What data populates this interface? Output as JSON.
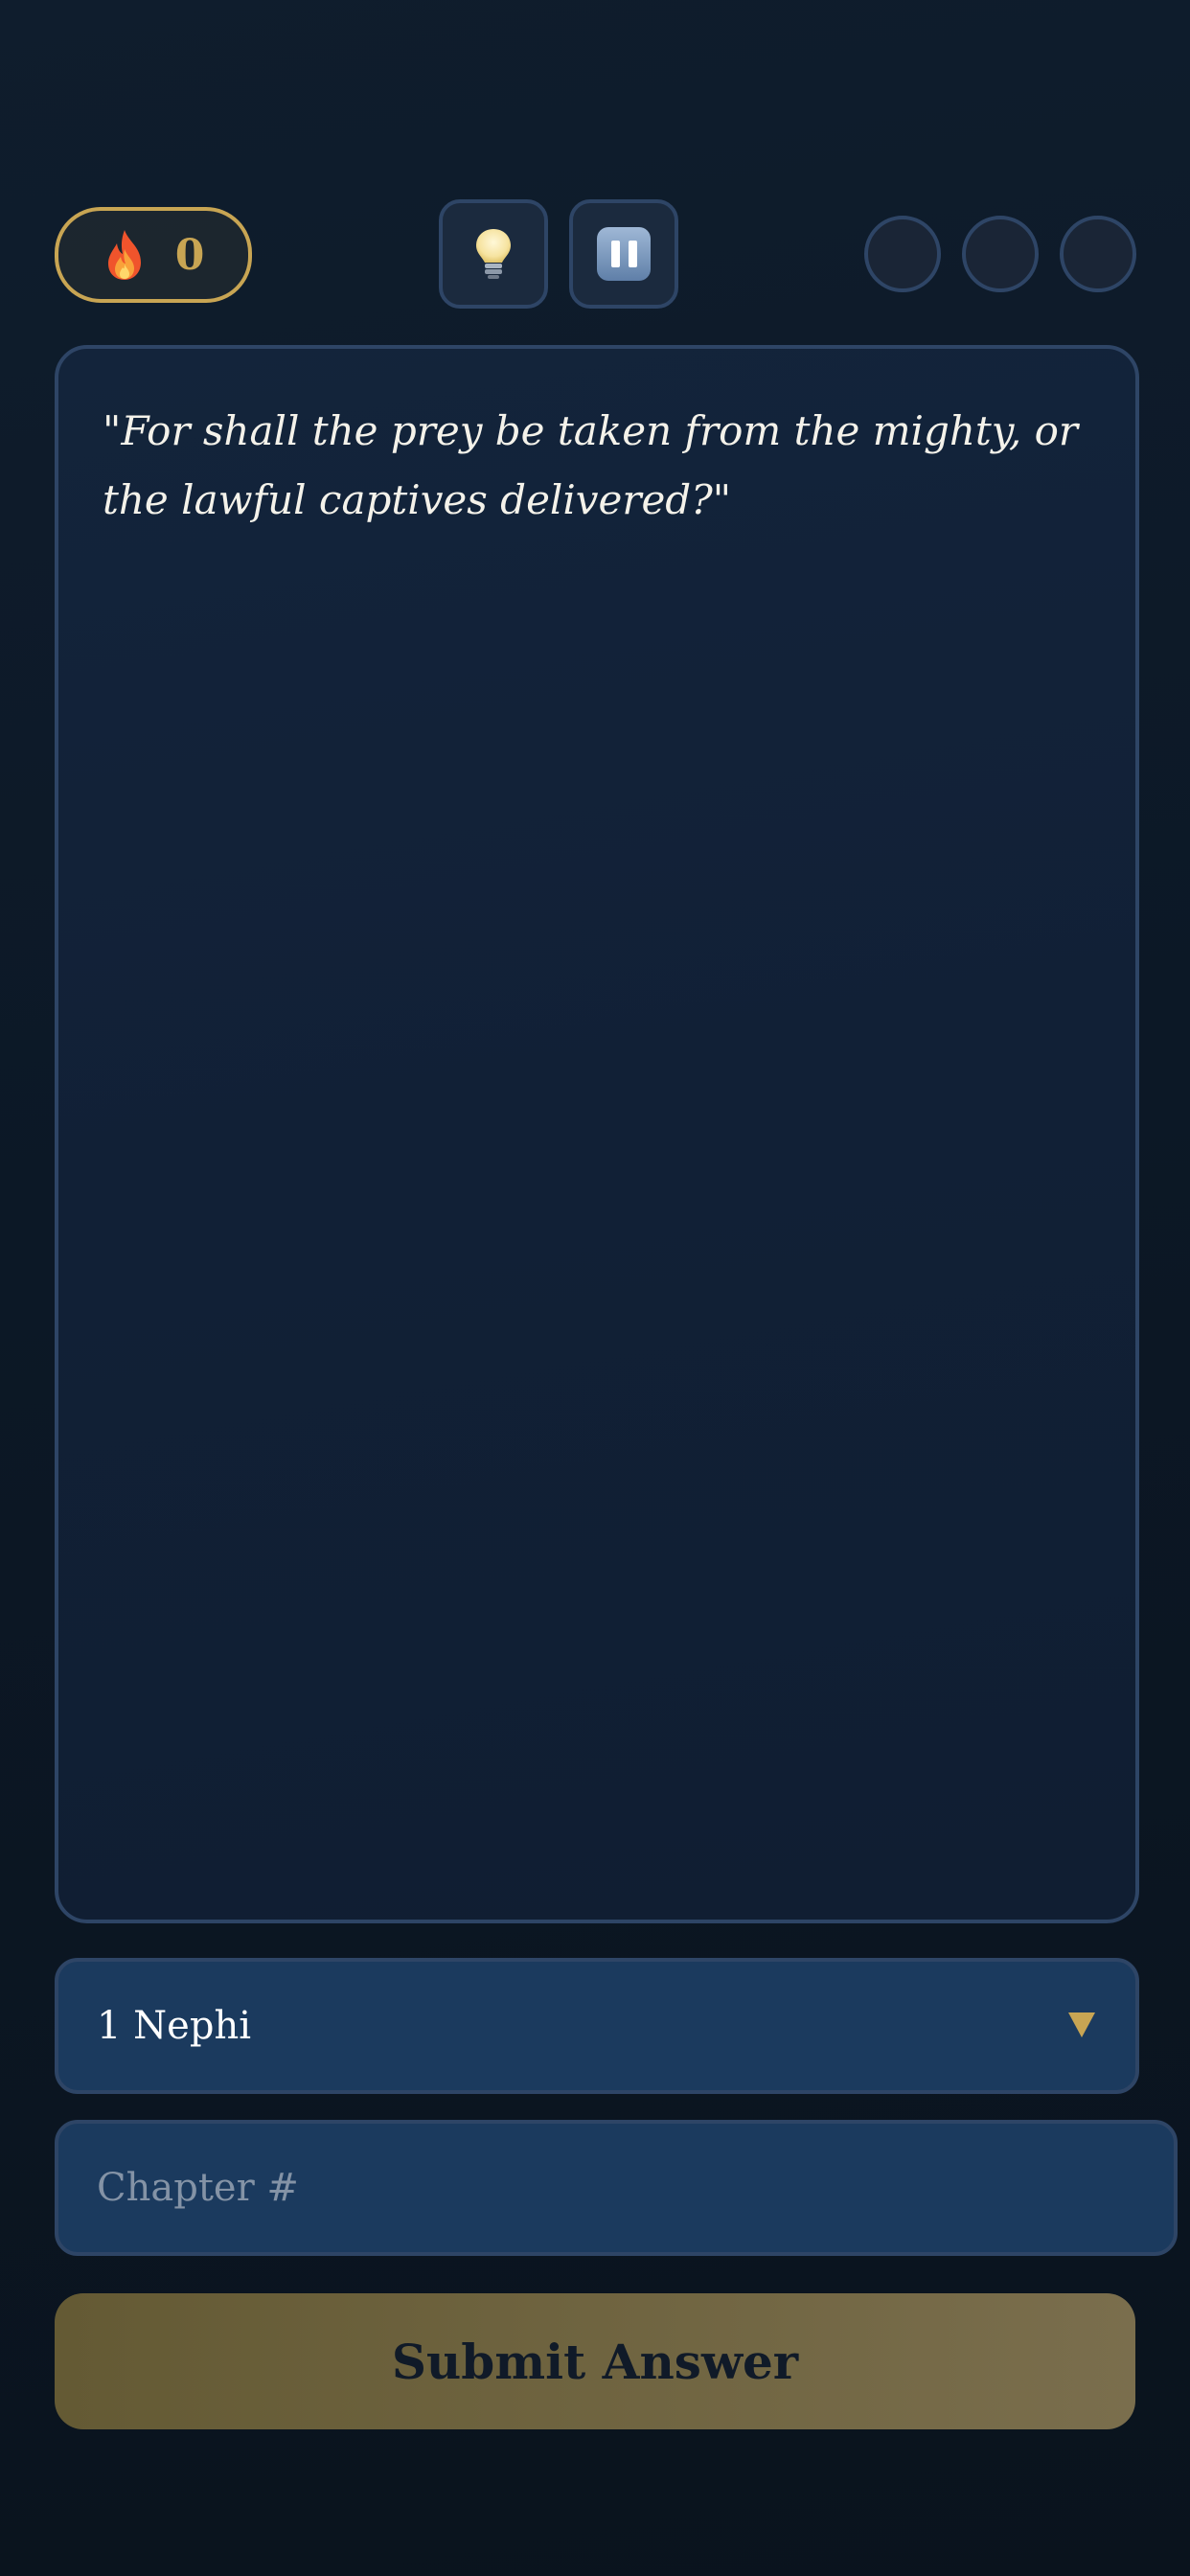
{
  "header": {
    "streak": {
      "icon": "fire-icon",
      "count": "0",
      "accent_color": "#c8a553"
    },
    "hint_button": {
      "icon": "lightbulb-icon"
    },
    "pause_button": {
      "icon": "pause-icon"
    },
    "progress_dots": [
      {
        "state": "empty"
      },
      {
        "state": "empty"
      },
      {
        "state": "empty"
      }
    ]
  },
  "verse": {
    "text": "\"For shall the prey be taken from the mighty, or the lawful captives delivered?\""
  },
  "answer_form": {
    "book_select": {
      "selected": "1 Nephi",
      "icon": "chevron-down-icon"
    },
    "chapter_input": {
      "value": "",
      "placeholder": "Chapter #"
    },
    "submit_label": "Submit Answer"
  },
  "colors": {
    "background": "#0c1826",
    "card_border": "#2e4566",
    "field_background": "#1b3a5e",
    "gold": "#c8a553"
  }
}
